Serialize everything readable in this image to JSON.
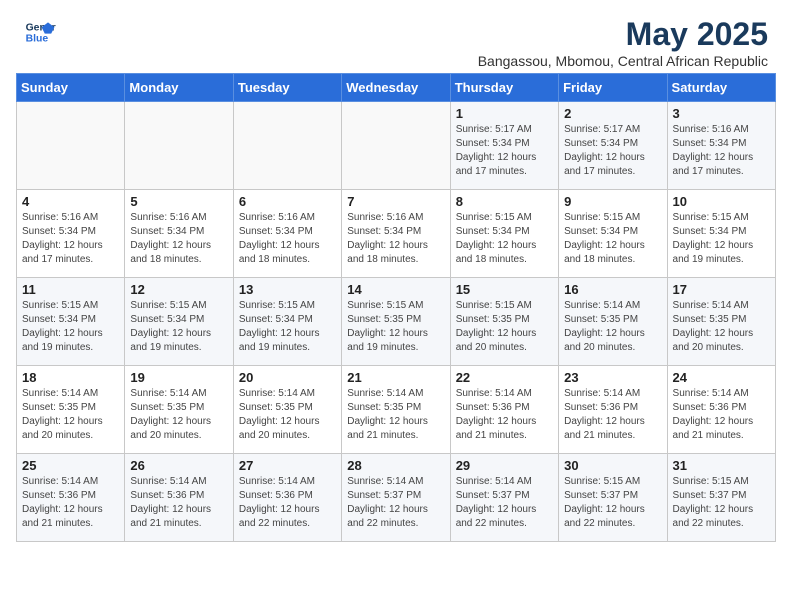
{
  "logo": {
    "line1": "General",
    "line2": "Blue"
  },
  "title": "May 2025",
  "subtitle": "Bangassou, Mbomou, Central African Republic",
  "weekdays": [
    "Sunday",
    "Monday",
    "Tuesday",
    "Wednesday",
    "Thursday",
    "Friday",
    "Saturday"
  ],
  "weeks": [
    [
      {
        "day": "",
        "info": ""
      },
      {
        "day": "",
        "info": ""
      },
      {
        "day": "",
        "info": ""
      },
      {
        "day": "",
        "info": ""
      },
      {
        "day": "1",
        "info": "Sunrise: 5:17 AM\nSunset: 5:34 PM\nDaylight: 12 hours\nand 17 minutes."
      },
      {
        "day": "2",
        "info": "Sunrise: 5:17 AM\nSunset: 5:34 PM\nDaylight: 12 hours\nand 17 minutes."
      },
      {
        "day": "3",
        "info": "Sunrise: 5:16 AM\nSunset: 5:34 PM\nDaylight: 12 hours\nand 17 minutes."
      }
    ],
    [
      {
        "day": "4",
        "info": "Sunrise: 5:16 AM\nSunset: 5:34 PM\nDaylight: 12 hours\nand 17 minutes."
      },
      {
        "day": "5",
        "info": "Sunrise: 5:16 AM\nSunset: 5:34 PM\nDaylight: 12 hours\nand 18 minutes."
      },
      {
        "day": "6",
        "info": "Sunrise: 5:16 AM\nSunset: 5:34 PM\nDaylight: 12 hours\nand 18 minutes."
      },
      {
        "day": "7",
        "info": "Sunrise: 5:16 AM\nSunset: 5:34 PM\nDaylight: 12 hours\nand 18 minutes."
      },
      {
        "day": "8",
        "info": "Sunrise: 5:15 AM\nSunset: 5:34 PM\nDaylight: 12 hours\nand 18 minutes."
      },
      {
        "day": "9",
        "info": "Sunrise: 5:15 AM\nSunset: 5:34 PM\nDaylight: 12 hours\nand 18 minutes."
      },
      {
        "day": "10",
        "info": "Sunrise: 5:15 AM\nSunset: 5:34 PM\nDaylight: 12 hours\nand 19 minutes."
      }
    ],
    [
      {
        "day": "11",
        "info": "Sunrise: 5:15 AM\nSunset: 5:34 PM\nDaylight: 12 hours\nand 19 minutes."
      },
      {
        "day": "12",
        "info": "Sunrise: 5:15 AM\nSunset: 5:34 PM\nDaylight: 12 hours\nand 19 minutes."
      },
      {
        "day": "13",
        "info": "Sunrise: 5:15 AM\nSunset: 5:34 PM\nDaylight: 12 hours\nand 19 minutes."
      },
      {
        "day": "14",
        "info": "Sunrise: 5:15 AM\nSunset: 5:35 PM\nDaylight: 12 hours\nand 19 minutes."
      },
      {
        "day": "15",
        "info": "Sunrise: 5:15 AM\nSunset: 5:35 PM\nDaylight: 12 hours\nand 20 minutes."
      },
      {
        "day": "16",
        "info": "Sunrise: 5:14 AM\nSunset: 5:35 PM\nDaylight: 12 hours\nand 20 minutes."
      },
      {
        "day": "17",
        "info": "Sunrise: 5:14 AM\nSunset: 5:35 PM\nDaylight: 12 hours\nand 20 minutes."
      }
    ],
    [
      {
        "day": "18",
        "info": "Sunrise: 5:14 AM\nSunset: 5:35 PM\nDaylight: 12 hours\nand 20 minutes."
      },
      {
        "day": "19",
        "info": "Sunrise: 5:14 AM\nSunset: 5:35 PM\nDaylight: 12 hours\nand 20 minutes."
      },
      {
        "day": "20",
        "info": "Sunrise: 5:14 AM\nSunset: 5:35 PM\nDaylight: 12 hours\nand 20 minutes."
      },
      {
        "day": "21",
        "info": "Sunrise: 5:14 AM\nSunset: 5:35 PM\nDaylight: 12 hours\nand 21 minutes."
      },
      {
        "day": "22",
        "info": "Sunrise: 5:14 AM\nSunset: 5:36 PM\nDaylight: 12 hours\nand 21 minutes."
      },
      {
        "day": "23",
        "info": "Sunrise: 5:14 AM\nSunset: 5:36 PM\nDaylight: 12 hours\nand 21 minutes."
      },
      {
        "day": "24",
        "info": "Sunrise: 5:14 AM\nSunset: 5:36 PM\nDaylight: 12 hours\nand 21 minutes."
      }
    ],
    [
      {
        "day": "25",
        "info": "Sunrise: 5:14 AM\nSunset: 5:36 PM\nDaylight: 12 hours\nand 21 minutes."
      },
      {
        "day": "26",
        "info": "Sunrise: 5:14 AM\nSunset: 5:36 PM\nDaylight: 12 hours\nand 21 minutes."
      },
      {
        "day": "27",
        "info": "Sunrise: 5:14 AM\nSunset: 5:36 PM\nDaylight: 12 hours\nand 22 minutes."
      },
      {
        "day": "28",
        "info": "Sunrise: 5:14 AM\nSunset: 5:37 PM\nDaylight: 12 hours\nand 22 minutes."
      },
      {
        "day": "29",
        "info": "Sunrise: 5:14 AM\nSunset: 5:37 PM\nDaylight: 12 hours\nand 22 minutes."
      },
      {
        "day": "30",
        "info": "Sunrise: 5:15 AM\nSunset: 5:37 PM\nDaylight: 12 hours\nand 22 minutes."
      },
      {
        "day": "31",
        "info": "Sunrise: 5:15 AM\nSunset: 5:37 PM\nDaylight: 12 hours\nand 22 minutes."
      }
    ]
  ]
}
